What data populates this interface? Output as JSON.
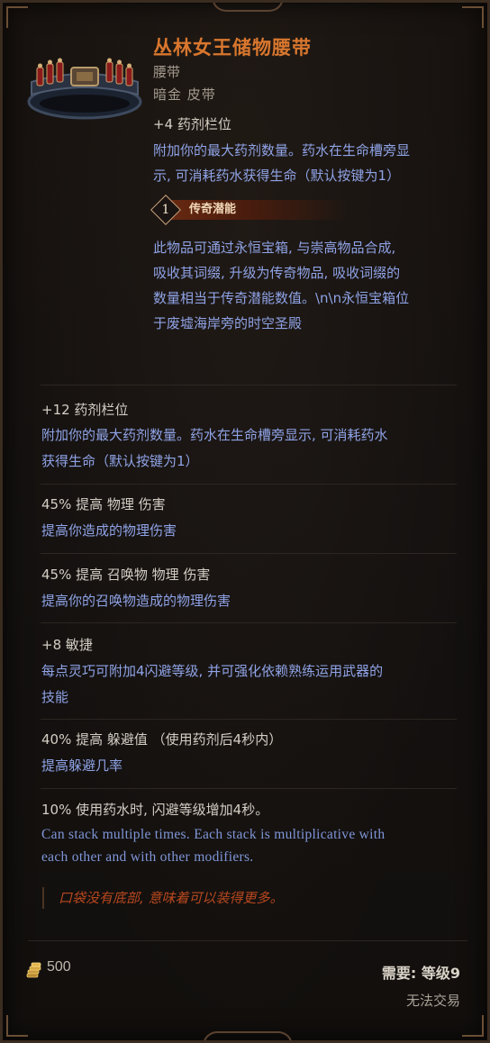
{
  "item": {
    "name": "丛林女王储物腰带",
    "type": "腰带",
    "rarity": "暗金 皮带",
    "icon": "belt-icon"
  },
  "implicit": {
    "mod": "+4 药剂栏位",
    "desc_1": "附加你的最大药剂数量。药水在生命槽旁显",
    "desc_2": "示, 可消耗药水获得生命（默认按键为1）"
  },
  "legendary_potential": {
    "value": "1",
    "label": "传奇潜能",
    "desc_1": "此物品可通过永恒宝箱, 与崇高物品合成,",
    "desc_2": "吸收其词缀, 升级为传奇物品, 吸收词缀的",
    "desc_3": "数量相当于传奇潜能数值。\\n\\n永恒宝箱位",
    "desc_4": "于废墟海岸旁的时空圣殿"
  },
  "affixes": [
    {
      "mod": "+12 药剂栏位",
      "desc_1": "附加你的最大药剂数量。药水在生命槽旁显示, 可消耗药水",
      "desc_2": "获得生命（默认按键为1）"
    },
    {
      "mod": "45% 提高 物理 伤害",
      "desc_1": "提高你造成的物理伤害"
    },
    {
      "mod": "45% 提高 召唤物 物理 伤害",
      "desc_1": "提高你的召唤物造成的物理伤害"
    },
    {
      "mod": "+8 敏捷",
      "desc_1": "每点灵巧可附加4闪避等级, 并可强化依赖熟练运用武器的",
      "desc_2": "技能"
    },
    {
      "mod": "40% 提高 躲避值 （使用药剂后4秒内）",
      "desc_1": "提高躲避几率"
    },
    {
      "mod": "10% 使用药水时, 闪避等级增加4秒。",
      "desc_1": "Can stack multiple times. Each stack is multiplicative with",
      "desc_2": "each other and with other modifiers."
    }
  ],
  "lore": "口袋没有底部, 意味着可以装得更多。",
  "footer": {
    "gold_icon": "gold-coins-icon",
    "gold_value": "500",
    "requirement": "需要: 等级9",
    "trade_status": "无法交易"
  },
  "colors": {
    "name": "#d9772e",
    "description": "#8fa3e6",
    "lore": "#b9481f"
  }
}
